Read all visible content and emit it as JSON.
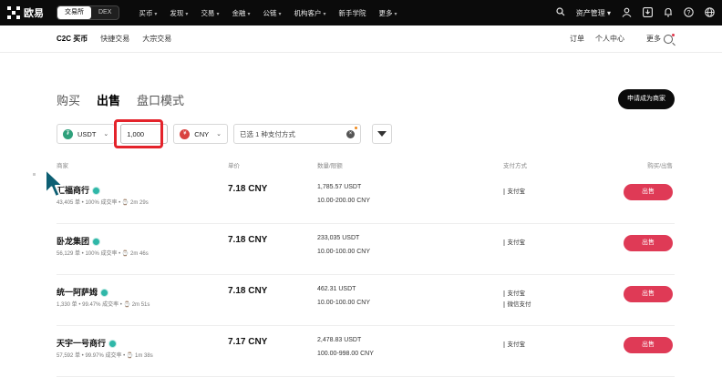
{
  "brand": {
    "name": "欧易"
  },
  "mode_switch": {
    "exchange": "交易所",
    "dex": "DEX"
  },
  "nav": [
    {
      "label": "买币",
      "has_menu": true
    },
    {
      "label": "发现",
      "has_menu": true
    },
    {
      "label": "交易",
      "has_menu": true
    },
    {
      "label": "金融",
      "has_menu": true
    },
    {
      "label": "公链",
      "has_menu": true
    },
    {
      "label": "机构客户",
      "has_menu": true
    },
    {
      "label": "新手学院",
      "has_menu": false
    },
    {
      "label": "更多",
      "has_menu": true
    }
  ],
  "top_right": {
    "asset_mgmt": "资产管理"
  },
  "subnav": {
    "left": [
      "C2C 买币",
      "快捷交易",
      "大宗交易"
    ],
    "right": [
      "订单",
      "个人中心",
      "更多"
    ]
  },
  "tabs": [
    "购买",
    "出售",
    "盘口模式"
  ],
  "merchant_button": "申请成为商家",
  "filters": {
    "coin": "USDT",
    "amount": "1,000",
    "fiat": "CNY",
    "payment": "已选 1 种支付方式"
  },
  "table_headers": {
    "merchant": "商家",
    "price": "单价",
    "amount": "数量/限额",
    "payment": "支付方式",
    "action": "购买/出售"
  },
  "rows": [
    {
      "name": "汇福商行",
      "stats": "43,405 单 • 100% 成交率 • ⌚ 2m 29s",
      "price": "7.18 CNY",
      "available": "1,785.57 USDT",
      "limit": "10.00-200.00 CNY",
      "payments": [
        "支付宝"
      ],
      "action": "出售"
    },
    {
      "name": "卧龙集团",
      "stats": "56,129 单 • 100% 成交率 • ⌚ 2m 46s",
      "price": "7.18 CNY",
      "available": "233,035 USDT",
      "limit": "10.00-100.00 CNY",
      "payments": [
        "支付宝"
      ],
      "action": "出售"
    },
    {
      "name": "统一阿萨姆",
      "stats": "1,330 单 • 99.47% 成交率 • ⌚ 2m 51s",
      "price": "7.18 CNY",
      "available": "462.31 USDT",
      "limit": "10.00-100.00 CNY",
      "payments": [
        "支付宝",
        "微信支付"
      ],
      "action": "出售"
    },
    {
      "name": "天宇一号商行",
      "stats": "57,592 单 • 99.97% 成交率 • ⌚ 1m 38s",
      "price": "7.17 CNY",
      "available": "2,478.83 USDT",
      "limit": "100.00-998.00 CNY",
      "payments": [
        "支付宝"
      ],
      "action": "出售"
    }
  ],
  "colors": {
    "topbar": "#0b0b0b",
    "sell_button": "#df3a56",
    "highlight": "#e4232b",
    "usdt": "#2ea07b",
    "cny": "#d9423f"
  }
}
